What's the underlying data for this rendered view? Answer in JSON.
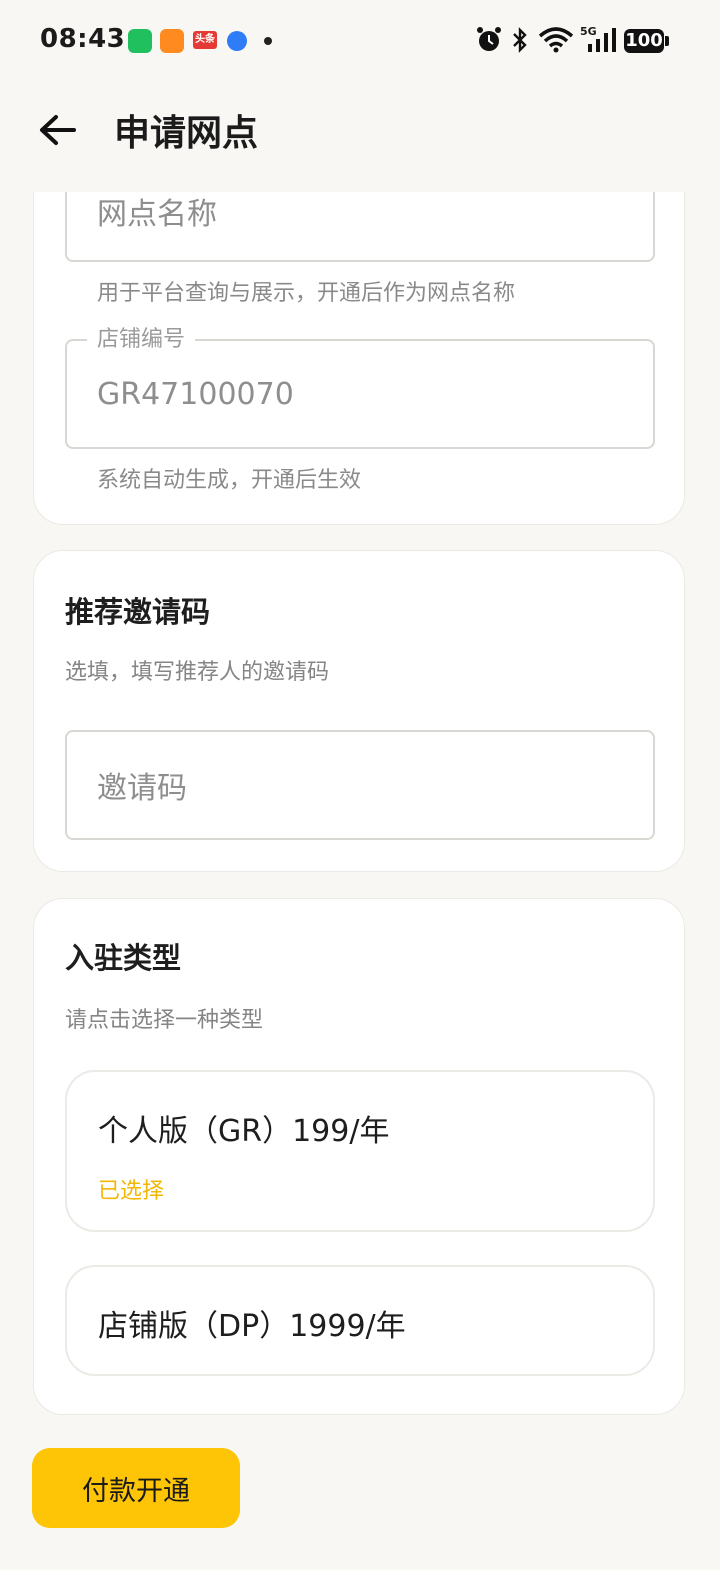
{
  "status_bar": {
    "time": "08:43",
    "news_badge": "头条",
    "network": "5G",
    "battery": "100"
  },
  "header": {
    "title": "申请网点",
    "back_icon": "arrow-left-icon"
  },
  "shop_info": {
    "name_field": {
      "placeholder": "网点名称",
      "helper": "用于平台查询与展示，开通后作为网点名称"
    },
    "code_field": {
      "label": "店铺编号",
      "value": "GR47100070",
      "helper": "系统自动生成，开通后生效"
    }
  },
  "referral": {
    "title": "推荐邀请码",
    "subtitle": "选填，填写推荐人的邀请码",
    "input_placeholder": "邀请码"
  },
  "join_type": {
    "title": "入驻类型",
    "subtitle": "请点击选择一种类型",
    "options": [
      {
        "label": "个人版（GR）199/年",
        "state": "已选择"
      },
      {
        "label": "店铺版（DP）1999/年",
        "state": ""
      }
    ],
    "selected_color": "#f2b705"
  },
  "actions": {
    "pay_label": "付款开通",
    "accent_color": "#fdc506"
  }
}
